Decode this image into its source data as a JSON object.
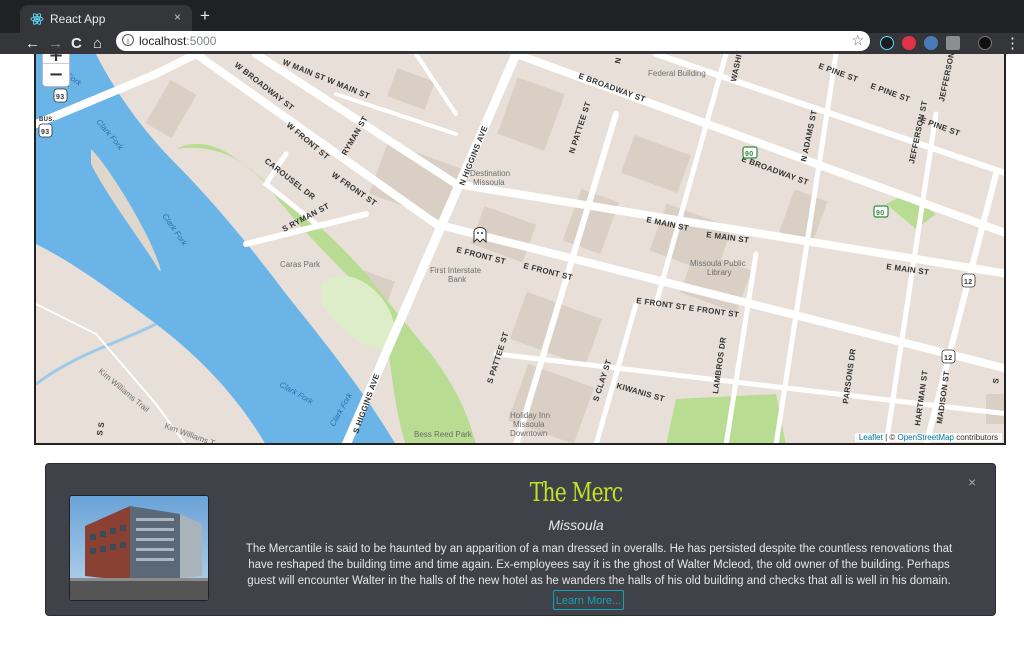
{
  "browser": {
    "tab_title": "React App",
    "tab_close": "×",
    "new_tab": "+",
    "url_host": "localhost",
    "url_port": ":5000",
    "back": "←",
    "forward": "→",
    "reload": "C",
    "home": "⌂",
    "star": "☆",
    "menu": "⋮"
  },
  "map": {
    "zoom_in": "+",
    "zoom_out": "−",
    "attribution_leaflet": "Leaflet",
    "attribution_sep": " | © ",
    "attribution_osm": "OpenStreetMap",
    "attribution_tail": " contributors",
    "labels": {
      "federal": "Federal Building",
      "destination": "Destination",
      "destination2": "Missoula",
      "caras": "Caras Park",
      "first_interstate": "First Interstate",
      "first_interstate2": "Bank",
      "library": "Missoula Public",
      "library2": "Library",
      "holiday": "Holiday Inn",
      "holiday2": "Missoula",
      "holiday3": "Downtown",
      "bess": "Bess Reed Park",
      "clark1": "Clark Fork",
      "clark2": "Clark Fork",
      "clark3": "Clark Fork",
      "clark4": "Clark Fork",
      "fork": "Fork",
      "kim1": "Kim Williams Trail",
      "kim2": "Kim Williams T",
      "w_main": "W MAIN ST W MAIN ST",
      "w_front": "W FRONT ST",
      "w_front2": "W FRONT ST",
      "w_front3": "W FRONT ST",
      "w_broadway": "W BROADWAY ST",
      "e_broadway": "E BROADWAY ST",
      "e_broadway2": "E BROADWAY ST",
      "e_pine": "E PINE ST",
      "e_pine2": "E PINE ST",
      "e_pine3": "E PINE ST",
      "e_main": "E MAIN ST",
      "e_main2": "E MAIN ST",
      "e_main3": "E MAIN ST",
      "e_front": "E FRONT ST",
      "e_front2": "E FRONT ST",
      "e_front3": "E FRONT ST E FRONT ST",
      "n_higgins": "N HIGGINS AVE",
      "s_higgins": "S HIGGINS AVE",
      "n_pattee": "N PATTEE ST",
      "s_pattee": "S PATTEE ST",
      "ryman": "RYMAN ST",
      "s_ryman": "S RYMAN ST",
      "carousel": "CAROUSEL DR",
      "n_adams": "N ADAMS ST",
      "jefferson": "JEFFERSON ST",
      "jefferson2": "JEFFERSON ST",
      "washington": "WASHI",
      "n_st": "N",
      "lambros": "LAMBROS DR",
      "kiwanis": "KIWANIS ST",
      "s_clay": "S CLAY ST",
      "parsons": "PARSONS DR",
      "hartman": "HARTMAN ST",
      "madison": "MADISON ST",
      "s_s": "S S",
      "s_right": "S",
      "shield_93": "93",
      "shield_90": "90",
      "shield_90b": "90",
      "shield_12": "12",
      "shield_12b": "12",
      "bus": "BUS."
    }
  },
  "card": {
    "title": "The Merc",
    "subtitle": "Missoula",
    "description": "The Mercantile is said to be haunted by an apparition of a man dressed in overalls. He has persisted despite the countless renovations that have reshaped the building time and time again. Ex-employees say it is the ghost of Walter Mcleod, the old owner of the building. Perhaps guest will encounter Walter in the halls of the new hotel as he wanders the halls of his old building and checks that all is well in his domain.",
    "learn_more": "Learn More...",
    "close": "×"
  },
  "colors": {
    "title": "#c6e026",
    "accent": "#17a2b8",
    "card_bg": "#3f4248",
    "river": "#6ab4e8",
    "park": "#b8dc92"
  }
}
